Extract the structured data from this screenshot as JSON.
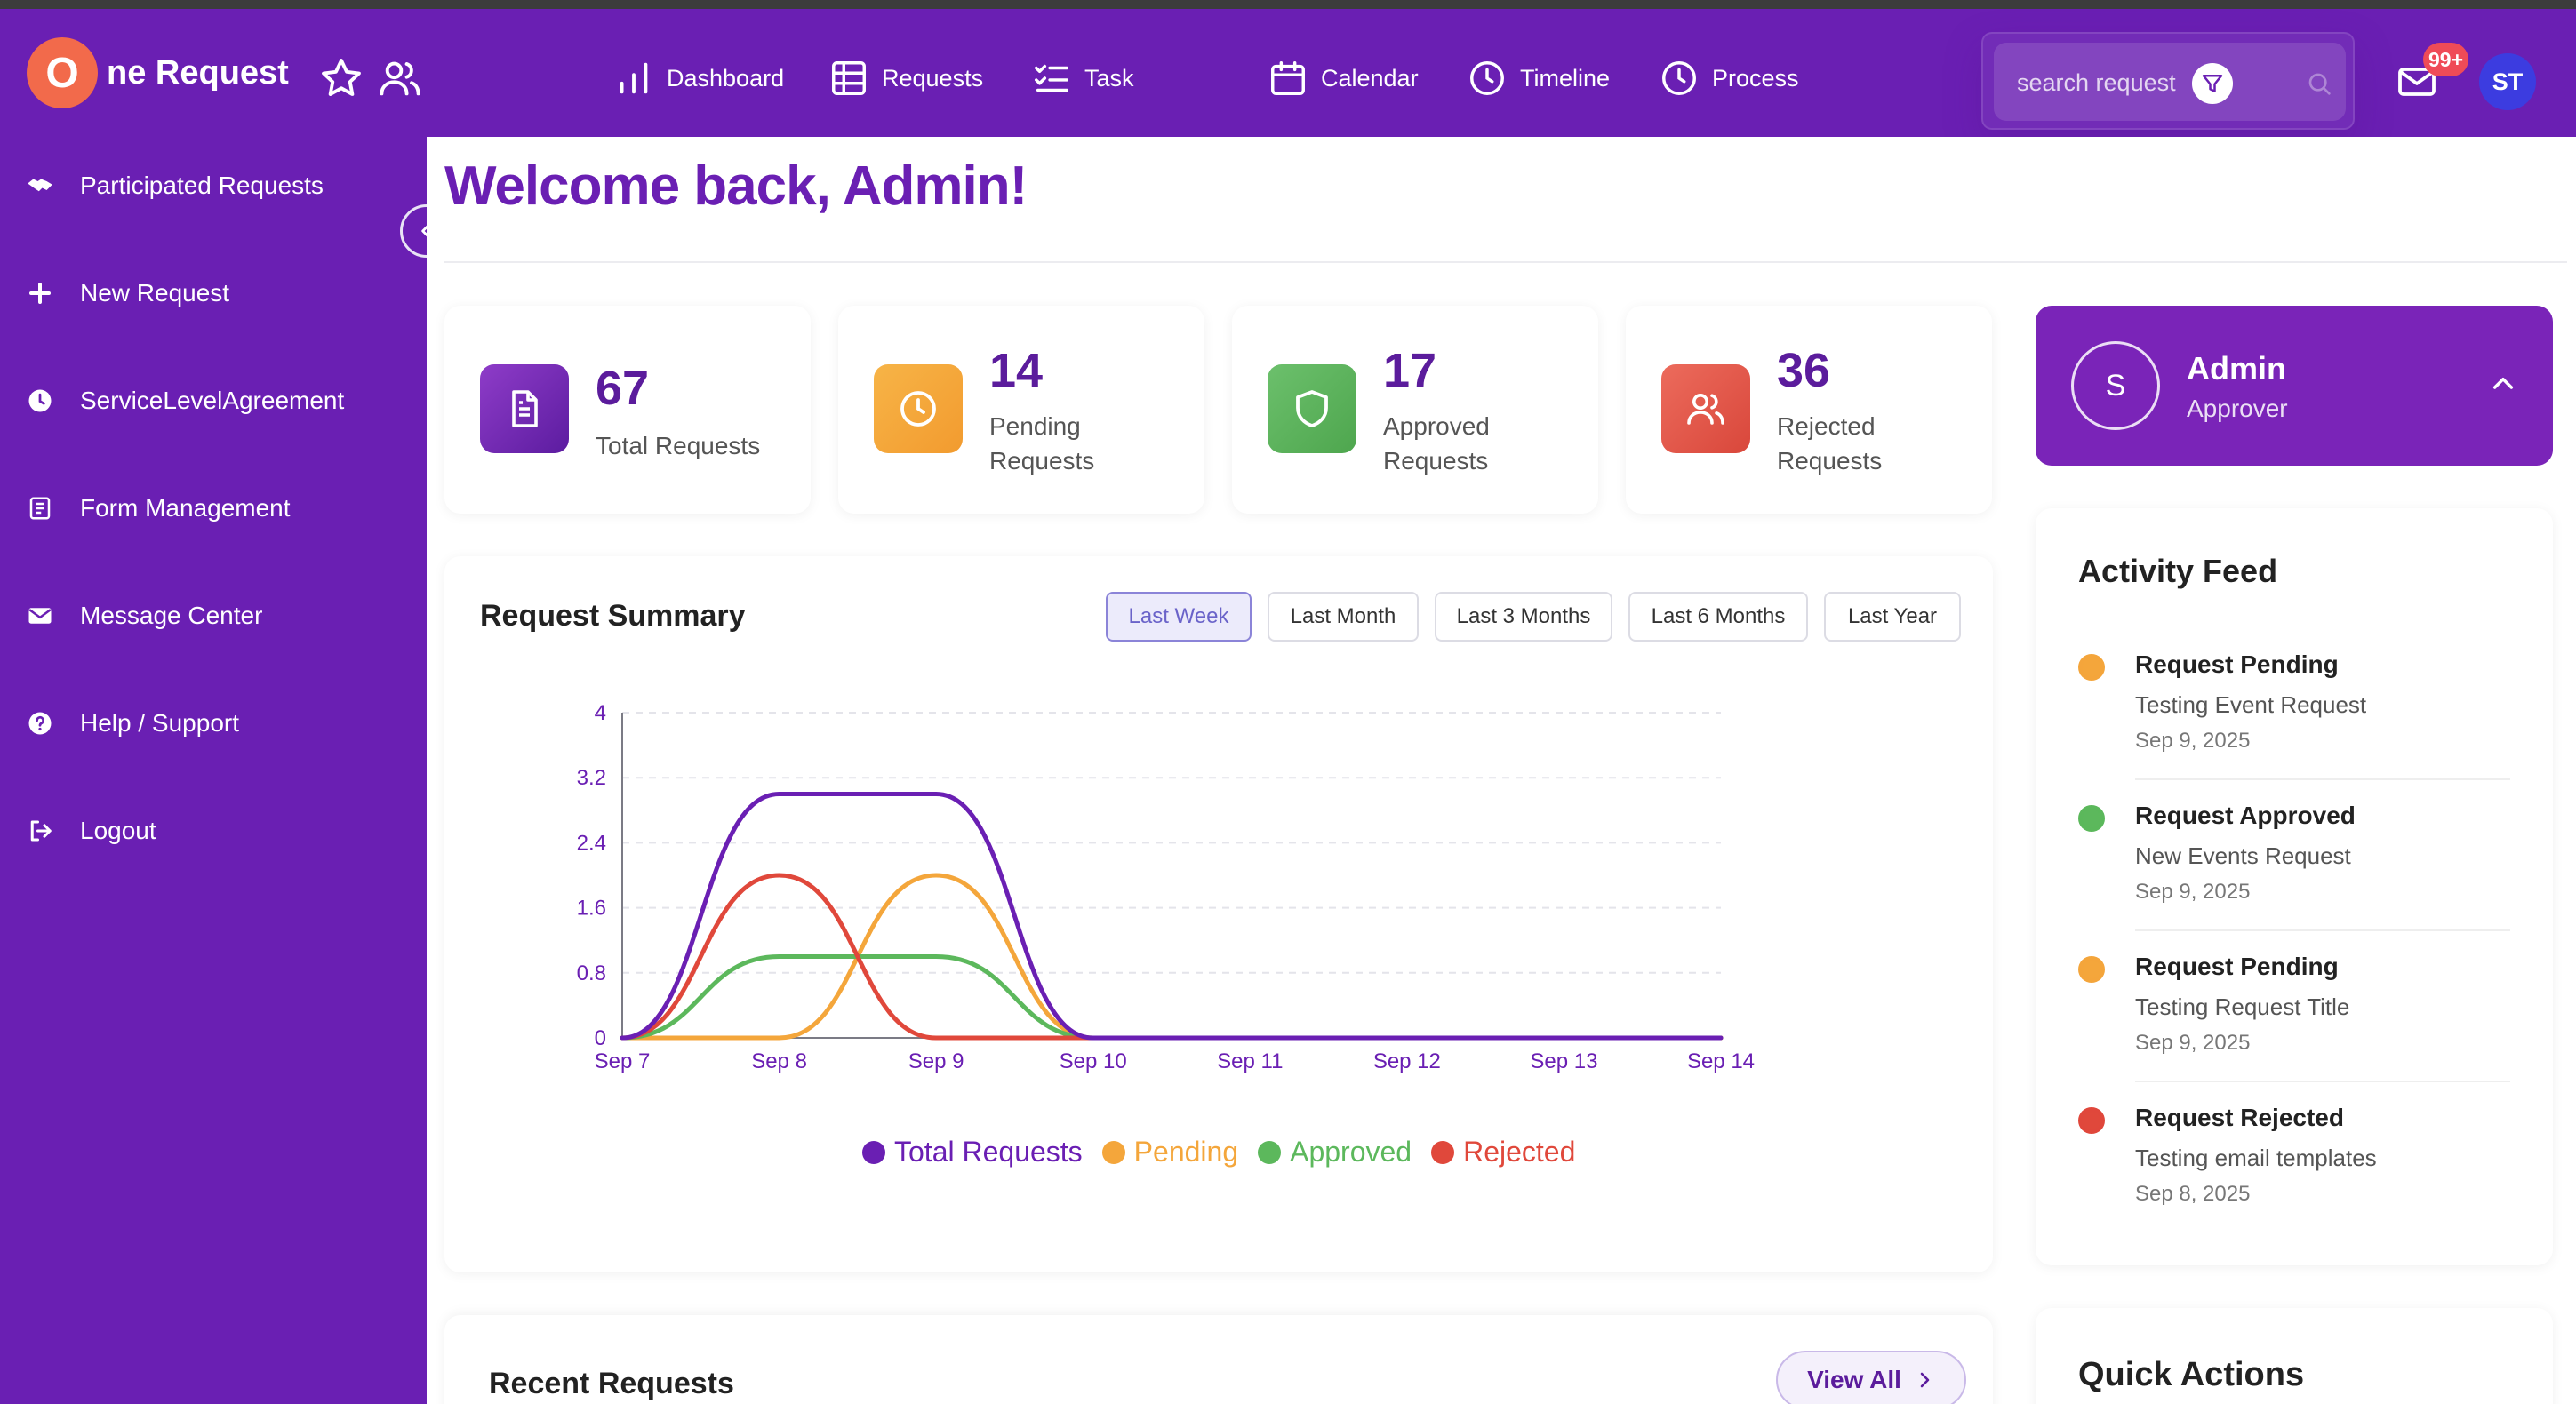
{
  "app": {
    "brand_letter": "O",
    "brand_rest": "ne Request"
  },
  "nav": [
    {
      "label": "Dashboard",
      "icon": "bar-chart-icon"
    },
    {
      "label": "Requests",
      "icon": "grid-icon"
    },
    {
      "label": "Task",
      "icon": "checklist-icon"
    },
    {
      "label": "Calendar",
      "icon": "calendar-icon"
    },
    {
      "label": "Timeline",
      "icon": "clock-icon"
    },
    {
      "label": "Process",
      "icon": "clock-icon"
    }
  ],
  "search": {
    "placeholder": "search request"
  },
  "notifications": {
    "badge": "99+"
  },
  "user": {
    "initials": "ST"
  },
  "sidebar": {
    "items": [
      {
        "label": "Participated Requests",
        "icon": "handshake-icon"
      },
      {
        "label": "New Request",
        "icon": "plus-icon"
      },
      {
        "label": "ServiceLevelAgreement",
        "icon": "clock-icon"
      },
      {
        "label": "Form Management",
        "icon": "form-icon"
      },
      {
        "label": "Message Center",
        "icon": "envelope-icon"
      },
      {
        "label": "Help / Support",
        "icon": "question-icon"
      },
      {
        "label": "Logout",
        "icon": "logout-icon"
      }
    ]
  },
  "main": {
    "welcome": "Welcome back, Admin!",
    "stats": [
      {
        "value": "67",
        "label_line1": "Total Requests",
        "label_line2": "",
        "color": "#7b2fb5"
      },
      {
        "value": "14",
        "label_line1": "Pending",
        "label_line2": "Requests",
        "color": "#f4a63b"
      },
      {
        "value": "17",
        "label_line1": "Approved",
        "label_line2": "Requests",
        "color": "#5cb85c"
      },
      {
        "value": "36",
        "label_line1": "Rejected",
        "label_line2": "Requests",
        "color": "#e25a4d"
      }
    ],
    "summary": {
      "title": "Request Summary",
      "ranges": [
        "Last Week",
        "Last Month",
        "Last 3 Months",
        "Last 6 Months",
        "Last Year"
      ],
      "active_range": "Last Week"
    },
    "recent": {
      "title": "Recent Requests",
      "view_all": "View All"
    }
  },
  "chart_data": {
    "type": "line",
    "x": [
      "Sep 7",
      "Sep 8",
      "Sep 9",
      "Sep 10",
      "Sep 11",
      "Sep 12",
      "Sep 13",
      "Sep 14"
    ],
    "ylim": [
      0,
      4
    ],
    "yticks": [
      "0",
      "0.8",
      "1.6",
      "2.4",
      "3.2",
      "4"
    ],
    "grid": true,
    "legend_position": "bottom",
    "series": [
      {
        "name": "Total Requests",
        "color": "#6a1fb3",
        "values": [
          0,
          3,
          3,
          0,
          0,
          0,
          0,
          0
        ]
      },
      {
        "name": "Pending",
        "color": "#f4a63b",
        "values": [
          0,
          0,
          2,
          0,
          0,
          0,
          0,
          0
        ]
      },
      {
        "name": "Approved",
        "color": "#5cb85c",
        "values": [
          0,
          1,
          1,
          0,
          0,
          0,
          0,
          0
        ]
      },
      {
        "name": "Rejected",
        "color": "#e0483b",
        "values": [
          0,
          2,
          0,
          0,
          0,
          0,
          0,
          0
        ]
      }
    ]
  },
  "profile": {
    "initial": "S",
    "name": "Admin",
    "role": "Approver"
  },
  "activity": {
    "title": "Activity Feed",
    "items": [
      {
        "title": "Request Pending",
        "subtitle": "Testing Event Request",
        "date": "Sep 9, 2025",
        "color": "#f4a63b"
      },
      {
        "title": "Request Approved",
        "subtitle": "New Events Request",
        "date": "Sep 9, 2025",
        "color": "#5cb85c"
      },
      {
        "title": "Request Pending",
        "subtitle": "Testing Request Title",
        "date": "Sep 9, 2025",
        "color": "#f4a63b"
      },
      {
        "title": "Request Rejected",
        "subtitle": "Testing email templates",
        "date": "Sep 8, 2025",
        "color": "#e0483b"
      }
    ]
  },
  "quick_actions": {
    "title": "Quick Actions"
  }
}
